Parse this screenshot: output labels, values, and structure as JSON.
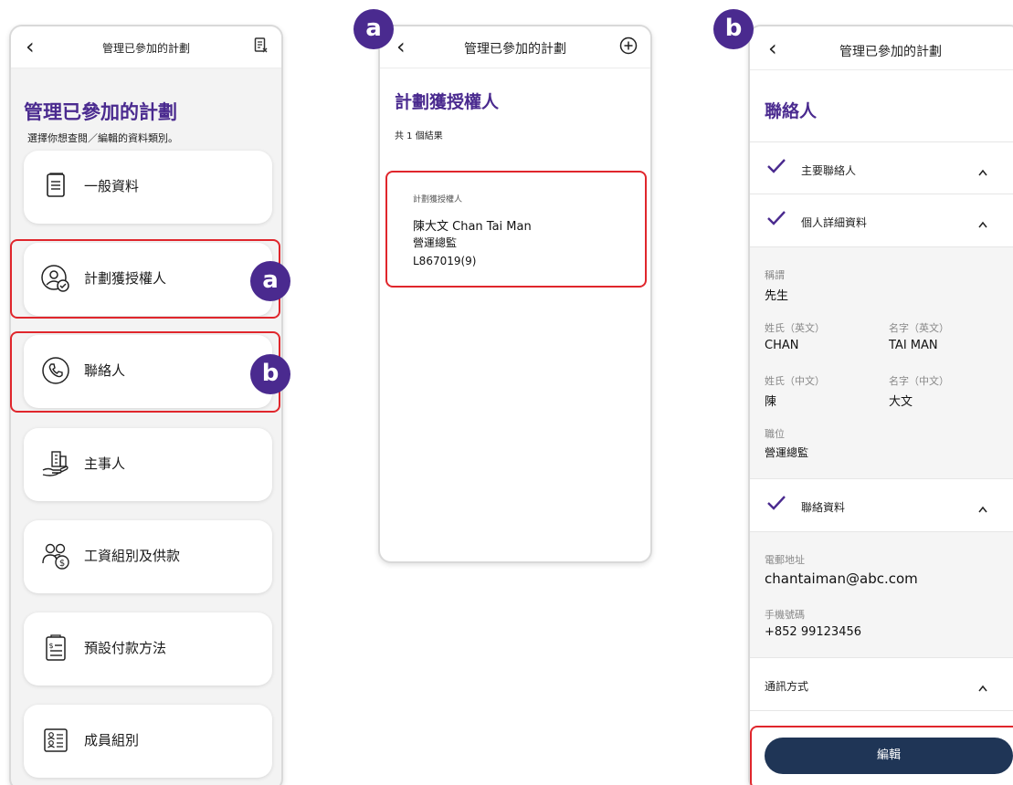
{
  "screen_general": {
    "nav_title": "管理已參加的計劃",
    "page_title": "管理已參加的計劃",
    "subtitle": "選擇你想查閱／編輯的資料類別。",
    "menu": [
      {
        "label": "一般資料",
        "icon": "document-icon"
      },
      {
        "label": "計劃獲授權人",
        "icon": "authorized-person-icon"
      },
      {
        "label": "聯絡人",
        "icon": "phone-icon"
      },
      {
        "label": "主事人",
        "icon": "building-hand-icon"
      },
      {
        "label": "工資組別及供款",
        "icon": "group-payroll-icon"
      },
      {
        "label": "預設付款方法",
        "icon": "payment-list-icon"
      },
      {
        "label": "成員組別",
        "icon": "member-group-icon"
      }
    ]
  },
  "badges": {
    "a": "a",
    "b": "b"
  },
  "screen_authorized": {
    "nav_title": "管理已參加的計劃",
    "page_title": "計劃獲授權人",
    "result_count": "共 1 個結果",
    "card": {
      "caption": "計劃獲授權人",
      "name": "陳大文 Chan Tai Man",
      "position": "營運總監",
      "id": "L867019(9)"
    }
  },
  "screen_contact": {
    "nav_title": "管理已參加的計劃",
    "page_title": "聯絡人",
    "sections": {
      "primary": "主要聯絡人",
      "personal": "個人詳細資料",
      "contact_info": "聯絡資料",
      "comm_method": "通訊方式"
    },
    "personal": {
      "title_label": "稱謂",
      "title_value": "先生",
      "surname_en_label": "姓氏（英文）",
      "surname_en_value": "CHAN",
      "given_en_label": "名字（英文）",
      "given_en_value": "TAI MAN",
      "surname_zh_label": "姓氏（中文）",
      "surname_zh_value": "陳",
      "given_zh_label": "名字（中文）",
      "given_zh_value": "大文",
      "position_label": "職位",
      "position_value": "營運總監"
    },
    "contact": {
      "email_label": "電郵地址",
      "email_value": "chantaiman@abc.com",
      "mobile_label": "手機號碼",
      "mobile_value": "+852 99123456"
    },
    "edit_button": "編輯"
  },
  "colors": {
    "brand_purple": "#4a2a8f",
    "highlight_red": "#e0262c",
    "button_navy": "#1f3556"
  }
}
